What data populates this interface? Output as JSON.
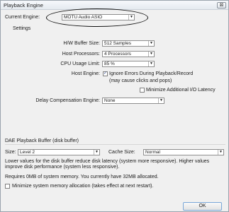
{
  "window": {
    "title": "Playback Engine",
    "close_glyph": "⊠"
  },
  "engine": {
    "label": "Current Engine:",
    "value": "MOTU Audio ASIO"
  },
  "settings": {
    "group_label": "Settings",
    "hw_buffer": {
      "label": "H/W Buffer Size:",
      "value": "512 Samples"
    },
    "host_processors": {
      "label": "Host Processors:",
      "value": "4 Processors"
    },
    "cpu_usage": {
      "label": "CPU Usage Limit:",
      "value": "85 %"
    },
    "host_engine": {
      "label": "Host Engine:",
      "ignore_errors": {
        "label": "Ignore Errors During Playback/Record",
        "checked": true
      },
      "note": "(may cause clicks and pops)",
      "minimize_latency": {
        "label": "Minimize Additional I/O Latency",
        "checked": false
      }
    },
    "delay_comp": {
      "label": "Delay Compensation Engine:",
      "value": "None"
    }
  },
  "dae": {
    "group_label": "DAE Playback Buffer (disk buffer)",
    "size": {
      "label": "Size:",
      "value": "Level 2"
    },
    "cache": {
      "label": "Cache Size:",
      "value": "Normal"
    },
    "desc_line1": "Lower values for the disk buffer reduce disk latency (system more responsive).  Higher values",
    "desc_line2": "improve disk performance (system less responsive).",
    "memory_text": "Requires 0MB of system memory.  You currently have 32MB allocated.",
    "minimize_memory": {
      "label": "Minimize system memory allocation (takes effect at next restart).",
      "checked": false
    }
  },
  "buttons": {
    "ok": "OK"
  },
  "icons": {
    "dropdown": "chevron-down-icon",
    "check": "checkmark-icon"
  },
  "colors": {
    "accent": "#1f3c88",
    "ok_border": "#7aa7d8"
  }
}
